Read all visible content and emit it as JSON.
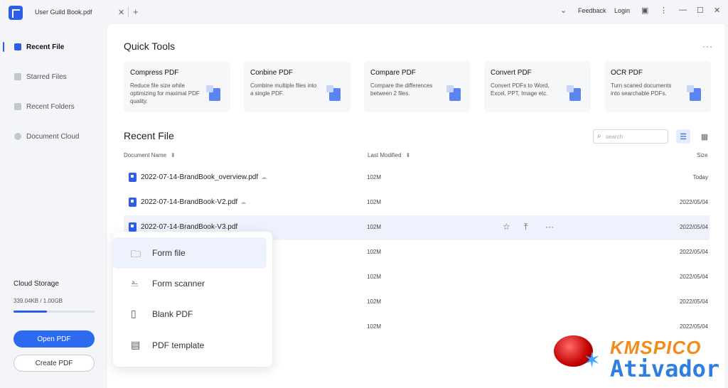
{
  "titlebar": {
    "tab_title": "User Guild Book.pdf",
    "close_glyph": "✕",
    "add_glyph": "+",
    "feedback": "Feedback",
    "login": "Login"
  },
  "sidebar": {
    "items": [
      {
        "label": "Recent File",
        "active": true
      },
      {
        "label": "Starred Files"
      },
      {
        "label": "Recent Folders"
      },
      {
        "label": "Document Cloud"
      }
    ],
    "cloud_title": "Cloud Storage",
    "cloud_value": "339.04KB / 1.00GB",
    "cloud_fraction": 0.41,
    "open_label": "Open PDF",
    "create_label": "Create PDF"
  },
  "quick_tools": {
    "title": "Quick Tools",
    "cards": [
      {
        "title": "Compress PDF",
        "desc": "Reduce file size while optimizing for maximal PDF quality."
      },
      {
        "title": "Conbine PDF",
        "desc": "Combine multiple files into a single PDF."
      },
      {
        "title": "Compare PDF",
        "desc": "Compare the differences between 2 files."
      },
      {
        "title": "Convert PDF",
        "desc": "Convert PDFs to Word, Excel, PPT, Image etc."
      },
      {
        "title": "OCR PDF",
        "desc": "Turn scaned documents into searchable PDFs."
      }
    ]
  },
  "recent": {
    "title": "Recent File",
    "search_placeholder": "search",
    "columns": {
      "name": "Document Name",
      "modified": "Last Modified",
      "size": "Size"
    },
    "rows": [
      {
        "name": "2022-07-14-BrandBook_overview.pdf",
        "modified": "102M",
        "size": "Today",
        "cloud": true
      },
      {
        "name": "2022-07-14-BrandBook-V2.pdf",
        "modified": "102M",
        "size": "2022/05/04",
        "cloud": true
      },
      {
        "name": "2022-07-14-BrandBook-V3.pdf",
        "modified": "102M",
        "size": "2022/05/04",
        "highlight": true
      },
      {
        "name": "",
        "modified": "102M",
        "size": "2022/05/04"
      },
      {
        "name": "",
        "modified": "102M",
        "size": "2022/05/04"
      },
      {
        "name": "",
        "modified": "102M",
        "size": "2022/05/04"
      },
      {
        "name": "",
        "modified": "102M",
        "size": "2022/05/04"
      }
    ]
  },
  "create_menu": {
    "items": [
      {
        "label": "Form file",
        "icon": "folder-icon"
      },
      {
        "label": "Form scanner",
        "icon": "scanner-icon"
      },
      {
        "label": "Blank PDF",
        "icon": "blank-page-icon"
      },
      {
        "label": "PDF template",
        "icon": "template-icon"
      }
    ]
  },
  "watermark": {
    "line1": "KMSPICO",
    "line2": "Ativador"
  },
  "colors": {
    "accent": "#2c5ee8",
    "highlight": "#edf2fd",
    "watermark_orange": "#f28a1c",
    "watermark_blue": "#2f7fe0"
  }
}
